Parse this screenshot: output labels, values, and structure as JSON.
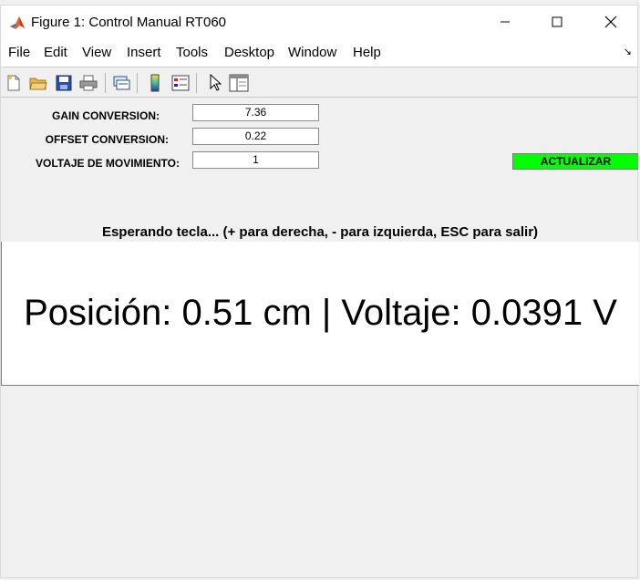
{
  "window": {
    "title": "Figure 1: Control Manual RT060",
    "controls": [
      "minimize-icon",
      "maximize-icon",
      "close-icon"
    ]
  },
  "menu": {
    "items": [
      "File",
      "Edit",
      "View",
      "Insert",
      "Tools",
      "Desktop",
      "Window",
      "Help"
    ]
  },
  "toolbar": {
    "icons": [
      "new-file-icon",
      "open-folder-icon",
      "save-icon",
      "print-icon",
      "link-plot-icon",
      "colorbar-icon",
      "legend-icon",
      "pointer-icon",
      "property-editor-icon"
    ]
  },
  "form": {
    "gain_label": "GAIN  CONVERSION:",
    "gain_value": "7.36",
    "offset_label": "OFFSET  CONVERSION:",
    "offset_value": "0.22",
    "voltage_label": "VOLTAJE DE MOVIMIENTO:",
    "voltage_value": "1",
    "update_button": "ACTUALIZAR"
  },
  "status": {
    "message": "Esperando tecla... (+ para derecha, - para izquierda, ESC para salir)"
  },
  "display": {
    "readout": "Posición: 0.51 cm | Voltaje: 0.0391 V"
  },
  "colors": {
    "update_button": "#00ff00",
    "background": "#f0f0f0"
  }
}
